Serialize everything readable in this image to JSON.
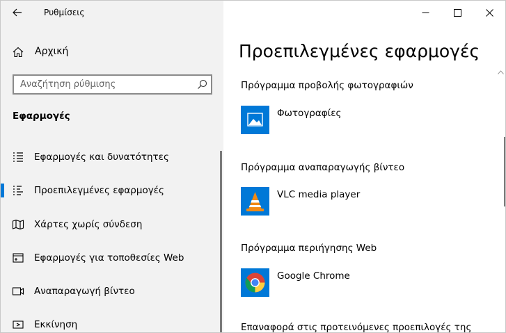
{
  "window": {
    "app_title": "Ρυθμίσεις"
  },
  "sidebar": {
    "home_label": "Αρχική",
    "search_placeholder": "Αναζήτηση ρύθμισης",
    "section_title": "Εφαρμογές",
    "items": [
      {
        "label": "Εφαρμογές και δυνατότητες",
        "icon": "list-icon"
      },
      {
        "label": "Προεπιλεγμένες εφαρμογές",
        "icon": "default-apps-icon",
        "selected": true
      },
      {
        "label": "Χάρτες χωρίς σύνδεση",
        "icon": "map-icon"
      },
      {
        "label": "Εφαρμογές για τοποθεσίες Web",
        "icon": "web-app-icon"
      },
      {
        "label": "Αναπαραγωγή βίντεο",
        "icon": "video-icon"
      },
      {
        "label": "Εκκίνηση",
        "icon": "startup-icon"
      }
    ]
  },
  "main": {
    "page_title": "Προεπιλεγμένες εφαρμογές",
    "categories": [
      {
        "label": "Πρόγραμμα προβολής φωτογραφιών",
        "app_name": "Φωτογραφίες",
        "icon": "photos-icon",
        "tile_color": "#0078d7"
      },
      {
        "label": "Πρόγραμμα αναπαραγωγής βίντεο",
        "app_name": "VLC media player",
        "icon": "vlc-icon",
        "tile_color": "#0078d7"
      },
      {
        "label": "Πρόγραμμα περιήγησης Web",
        "app_name": "Google Chrome",
        "icon": "chrome-icon",
        "tile_color": "#0078d7"
      }
    ],
    "reset_text": "Επαναφορά στις προτεινόμενες προεπιλογές της"
  },
  "colors": {
    "accent": "#0078d7",
    "sidebar_bg": "#f2f2f2"
  }
}
